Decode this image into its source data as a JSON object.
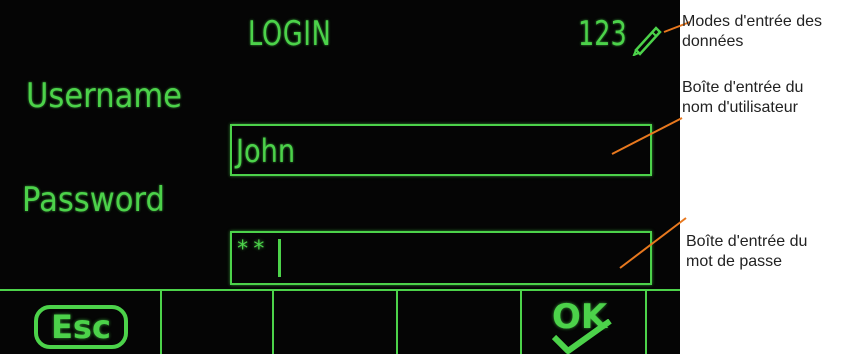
{
  "screen": {
    "title": "LOGIN",
    "input_mode": "123",
    "input_mode_icon": "pencil-icon",
    "username_label": "Username",
    "username_value": "John",
    "password_label": "Password",
    "password_value": "**"
  },
  "softkeys": {
    "esc_label": "Esc",
    "ok_label": "OK",
    "ok_icon": "checkmark-icon"
  },
  "annotations": {
    "modes_line1": "Modes d'entrée des",
    "modes_line2": "données",
    "username_line1": "Boîte d'entrée du",
    "username_line2": "nom d'utilisateur",
    "password_line1": "Boîte d'entrée du",
    "password_line2": "mot de passe"
  },
  "colors": {
    "display_bg": "#050505",
    "display_green": "#4cd24a",
    "leader_orange": "#e8781e"
  }
}
